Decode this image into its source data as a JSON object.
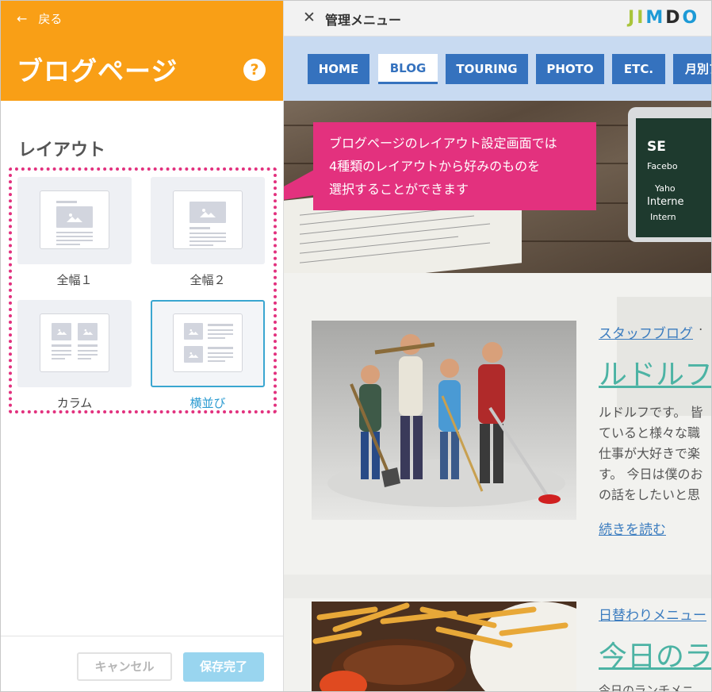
{
  "left_panel": {
    "back_label": "戻る",
    "title": "ブログページ",
    "help_label": "?",
    "layout_heading": "レイアウト",
    "options": [
      {
        "label": "全幅１"
      },
      {
        "label": "全幅２"
      },
      {
        "label": "カラム"
      },
      {
        "label": "横並び",
        "selected": true
      }
    ],
    "cancel_label": "キャンセル",
    "save_label": "保存完了"
  },
  "admin_bar": {
    "close_icon": "✕",
    "title": "管理メニュー",
    "logo": [
      "J",
      "I",
      "M",
      "D",
      "O"
    ],
    "logo_colors": [
      "#a9c43a",
      "#a9c43a",
      "#1d9ad6",
      "#2b2b2b",
      "#1d9ad6"
    ]
  },
  "nav": {
    "items": [
      {
        "label": "HOME"
      },
      {
        "label": "BLOG",
        "active": true
      },
      {
        "label": "TOURING"
      },
      {
        "label": "PHOTO"
      },
      {
        "label": "ETC."
      },
      {
        "label": "月別ア"
      }
    ]
  },
  "hero": {
    "screen_lines": [
      "SE",
      "Facebo",
      "Yaho",
      "Interne",
      "Intern"
    ]
  },
  "callout": {
    "lines": [
      "ブログページのレイアウト設定画面では",
      "4種類のレイアウトから好みのものを",
      "選択することができます"
    ]
  },
  "posts": [
    {
      "category": "スタッフブログ",
      "category_suffix": " ·",
      "title": "ルドルフ",
      "excerpt_lines": [
        "ルドルフです。 皆",
        "ていると様々な職",
        "仕事が大好きで楽",
        "す。 今日は僕のお",
        "の話をしたいと思"
      ],
      "more_label": "続きを読む"
    },
    {
      "category": "日替わりメニュー",
      "title": "今日のラ",
      "excerpt": "今日のランチメニ"
    }
  ],
  "colors": {
    "accent_orange": "#f99f16",
    "callout_pink": "#e3317e",
    "nav_blue": "#3572be",
    "selected_blue": "#3aa6d0",
    "title_teal": "#4cb3a4"
  }
}
